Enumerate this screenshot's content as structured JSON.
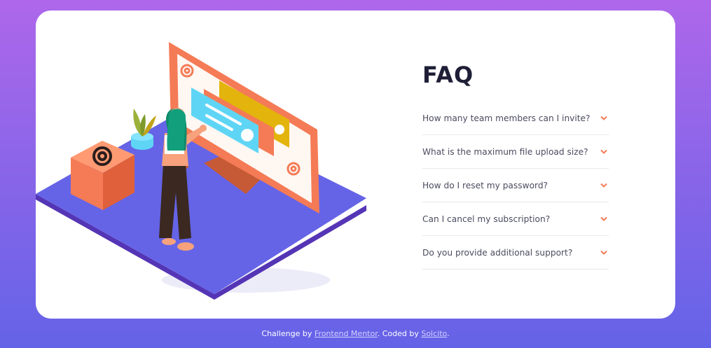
{
  "faq": {
    "title": "FAQ",
    "items": [
      {
        "question": "How many team members can I invite?"
      },
      {
        "question": "What is the maximum file upload size?"
      },
      {
        "question": "How do I reset my password?"
      },
      {
        "question": "Can I cancel my subscription?"
      },
      {
        "question": "Do you provide additional support?"
      }
    ]
  },
  "footer": {
    "prefix": "Challenge by ",
    "link1": "Frontend Mentor",
    "middle": ". Coded by ",
    "link2": "Solcito",
    "suffix": "."
  },
  "colors": {
    "bg_top": "#ae67ea",
    "bg_bottom": "#6463e7",
    "accent": "#f47b56",
    "heading": "#1e1f36",
    "text": "#4b4c5f",
    "divider": "#e8e8ea"
  },
  "icons": [
    "chevron-down-icon",
    "at-sign-icon"
  ]
}
